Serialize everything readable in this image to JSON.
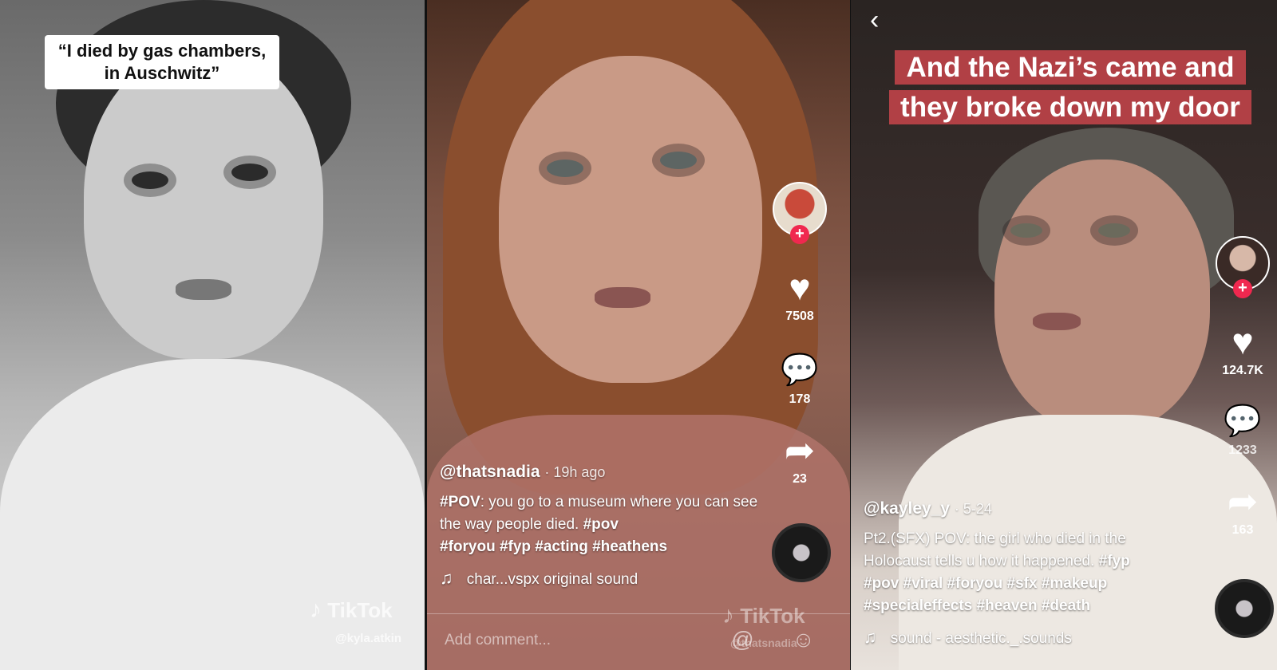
{
  "panel1": {
    "caption_line1": "“I died by gas chambers,",
    "caption_line2": "in Auschwitz”",
    "watermark": "TikTok",
    "watermark_user": "@kyla.atkin"
  },
  "panel2": {
    "likes": "7508",
    "comments": "178",
    "shares": "23",
    "username": "@thatsnadia",
    "time_ago": "· 19h ago",
    "desc_tag1": "#POV",
    "desc_text1": ": you go to a museum where you can see the way people died. ",
    "desc_tag2": "#pov",
    "desc_tags": "#foryou #fyp #acting #heathens",
    "music": "char...vspx     original sound",
    "watermark": "TikTok",
    "watermark_user": "@thatsnadia",
    "comment_placeholder": "Add comment...",
    "comment_icons": "@ ☺"
  },
  "panel3": {
    "caption": "And the Nazi’s came and they broke down my door",
    "likes": "124.7K",
    "comments": "1233",
    "shares": "163",
    "username": "@kayley_y",
    "date": "· 5-24",
    "desc_text": "Pt2.(SFX) POV: the girl who died in the Holocaust tells u how it happened. ",
    "desc_tags1": "#fyp",
    "desc_tags2": "#pov #viral #foryou #sfx #makeup #specialeffects #heaven #death",
    "music": "sound - aesthetic._.sounds"
  },
  "icons": {
    "heart": "♥",
    "comment": "💬",
    "share": "➦",
    "note": "♫",
    "plus": "+",
    "back": "‹",
    "tiktok": "♪"
  },
  "colors": {
    "plus_badge": "#f0284f",
    "caption_red": "#d6484e"
  }
}
